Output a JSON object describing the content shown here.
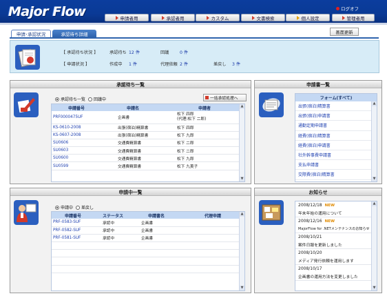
{
  "header": {
    "logo": "Major Flow",
    "logoff": "ログオフ",
    "menu": [
      {
        "label": "申請者用",
        "icon": "triangle-red-icon"
      },
      {
        "label": "承認者用",
        "icon": "triangle-red-icon"
      },
      {
        "label": "カスタム",
        "icon": "triangle-red-icon"
      },
      {
        "label": "文書検索",
        "icon": "triangle-red-icon"
      },
      {
        "label": "個人設定",
        "icon": "triangle-yellow-icon"
      },
      {
        "label": "管理者用",
        "icon": "triangle-red-icon"
      }
    ]
  },
  "tabs": [
    {
      "label": "申請･承認状況"
    },
    {
      "label": "承認待ち詳細"
    }
  ],
  "refresh_label": "画面更新",
  "summary": {
    "row1_label": "【 承認待ち状況 】",
    "pending_label": "承認待ち",
    "pending_value": "12 件",
    "circulation_label": "回議",
    "circulation_value": "0 件",
    "row2_label": "【 申請状況 】",
    "drafting_label": "作成中",
    "drafting_value": "1 件",
    "proxy_label": "代理依頼",
    "proxy_value": "2 件",
    "returned_label": "差戻し",
    "returned_value": "3 件"
  },
  "approval": {
    "title": "承認待ち一覧",
    "radio1": "承認待ち一覧",
    "radio2": "回議中",
    "bulk_button": "一括承認処理へ",
    "columns": [
      "申請番号",
      "申請名",
      "申請者"
    ],
    "rows": [
      {
        "no": "PRF0000475UF",
        "name": "企画書",
        "applicant": "松下 四郎",
        "applicant2": "(代理:松下 二郎)"
      },
      {
        "no": "KS-0610-2008",
        "name": "出張(宿泊)精算書",
        "applicant": "松下 四郎",
        "applicant2": ""
      },
      {
        "no": "KS-0607-2008",
        "name": "出張(宿泊)精算書",
        "applicant": "松下 九郎",
        "applicant2": ""
      },
      {
        "no": "SU0606",
        "name": "交通費精算書",
        "applicant": "松下 二郎",
        "applicant2": ""
      },
      {
        "no": "SU0603",
        "name": "交通費精算書",
        "applicant": "松下 二郎",
        "applicant2": ""
      },
      {
        "no": "SU0600",
        "name": "交通費精算書",
        "applicant": "松下 九郎",
        "applicant2": ""
      },
      {
        "no": "SU0599",
        "name": "交通費精算書",
        "applicant": "松下 九美子",
        "applicant2": ""
      }
    ]
  },
  "forms": {
    "title": "申請書一覧",
    "header": "フォーム(すべて)",
    "items": [
      "出張(宿泊)精算書",
      "出張(宿泊)申請書",
      "通勤定期申請書",
      "経費(宿泊)精算書",
      "経費(宿泊)申請書",
      "社外幹事費申請書",
      "支払申請書",
      "交際費(宿泊)精算書"
    ]
  },
  "applying": {
    "title": "申請中一覧",
    "radio1": "申請中",
    "radio2": "差戻し",
    "columns": [
      "申請番号",
      "ステータス",
      "申請書名",
      "代理申請"
    ],
    "rows": [
      {
        "no": "PRF-0583-SUF",
        "status": "承認中",
        "name": "企画書",
        "proxy": ""
      },
      {
        "no": "PRF-0582-SUF",
        "status": "承認中",
        "name": "企画書",
        "proxy": ""
      },
      {
        "no": "PRF-0581-SUF",
        "status": "承認中",
        "name": "企画書",
        "proxy": ""
      }
    ]
  },
  "news": {
    "title": "お知らせ",
    "new_label": "NEW",
    "items": [
      {
        "date": "2008/12/18",
        "new": true,
        "text": "年末年始の運用について"
      },
      {
        "date": "2008/12/16",
        "new": true,
        "text": "MajorFlow for .NETメンテナンスのお知らせ"
      },
      {
        "date": "2008/10/21",
        "new": false,
        "text": "案件日報を更新しました"
      },
      {
        "date": "2008/10/20",
        "new": false,
        "text": "メディア発行依頼を運用します"
      },
      {
        "date": "2008/10/17",
        "new": false,
        "text": "企画書の運用方法を変更しました"
      }
    ]
  },
  "colors": {
    "header_bg": "#0b3d9e",
    "accent": "#2e63ad",
    "summary_bg": "#d7ecf7",
    "link": "#1d3fb0",
    "new_badge": "#e08a00"
  }
}
